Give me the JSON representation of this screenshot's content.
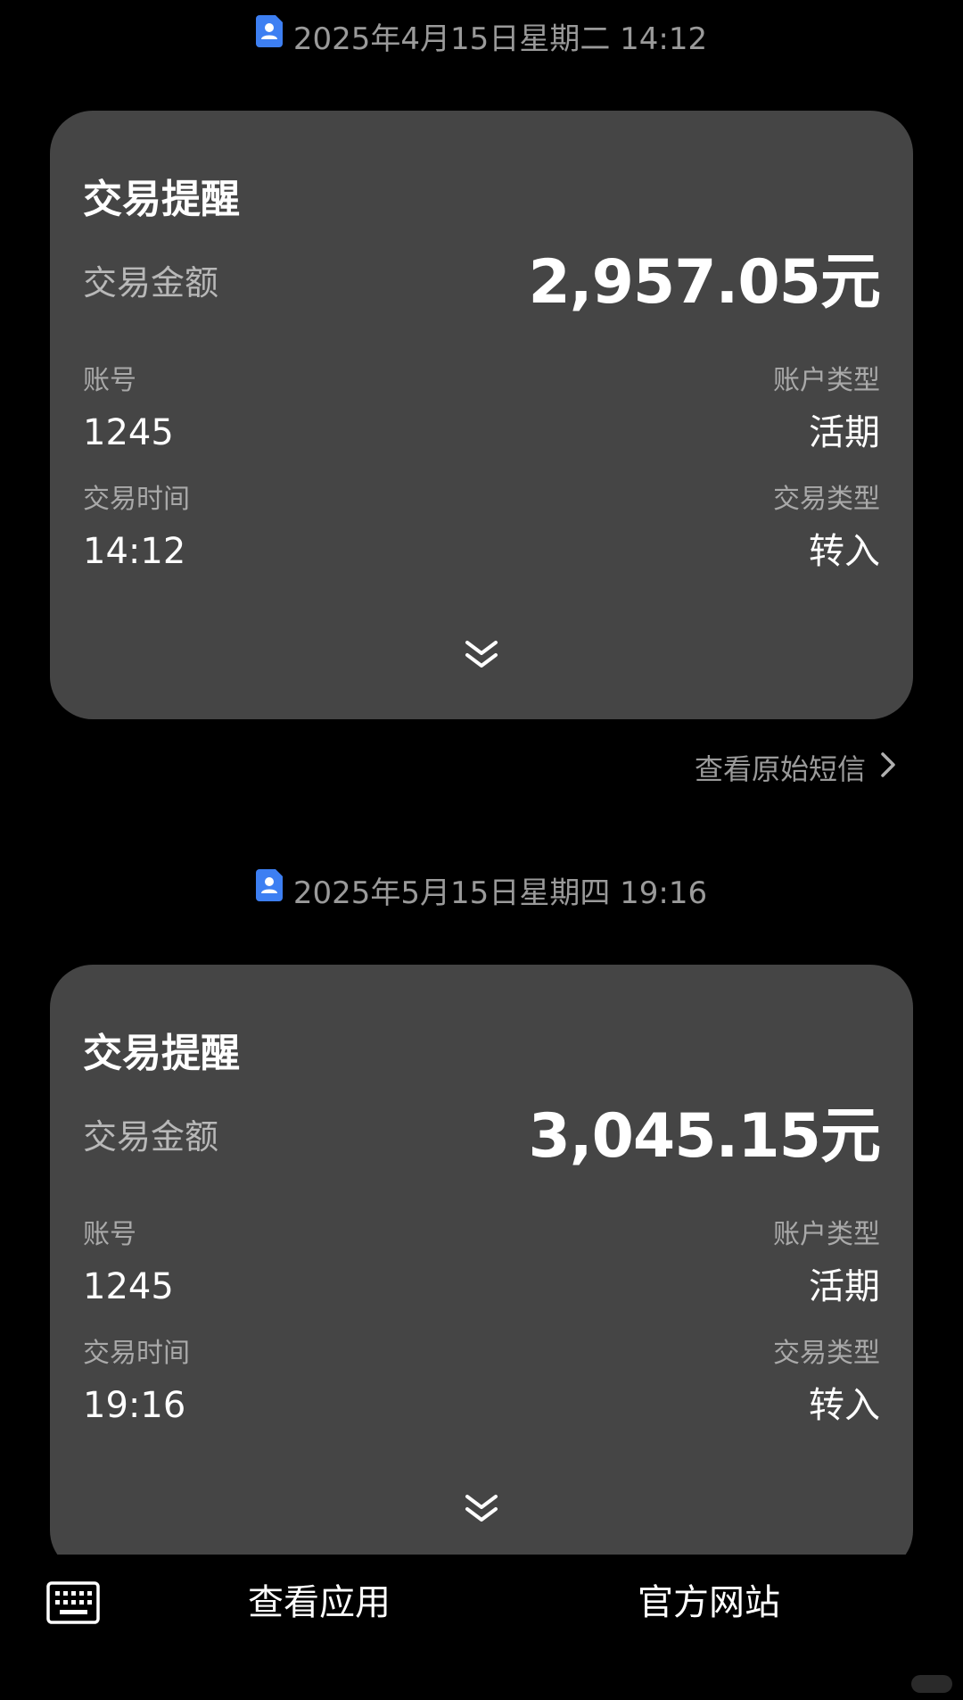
{
  "messages": [
    {
      "timestamp": "2025年4月15日星期二 14:12",
      "title": "交易提醒",
      "amount_label": "交易金额",
      "amount": "2,957.05元",
      "account_label": "账号",
      "account": "1245",
      "account_type_label": "账户类型",
      "account_type": "活期",
      "time_label": "交易时间",
      "time": "14:12",
      "txn_type_label": "交易类型",
      "txn_type": "转入"
    },
    {
      "timestamp": "2025年5月15日星期四 19:16",
      "title": "交易提醒",
      "amount_label": "交易金额",
      "amount": "3,045.15元",
      "account_label": "账号",
      "account": "1245",
      "account_type_label": "账户类型",
      "account_type": "活期",
      "time_label": "交易时间",
      "time": "19:16",
      "txn_type_label": "交易类型",
      "txn_type": "转入"
    }
  ],
  "view_original_label": "查看原始短信",
  "bottom_bar": {
    "keyboard_icon": "keyboard-icon",
    "view_app_label": "查看应用",
    "official_site_label": "官方网站"
  },
  "icons": {
    "sender": "contact-icon",
    "expand": "double-chevron-down-icon",
    "chevron": "chevron-right-icon"
  },
  "colors": {
    "background": "#000000",
    "card": "#454545",
    "accent_icon": "#3d7ff2",
    "muted_text": "#9a9a9a"
  }
}
